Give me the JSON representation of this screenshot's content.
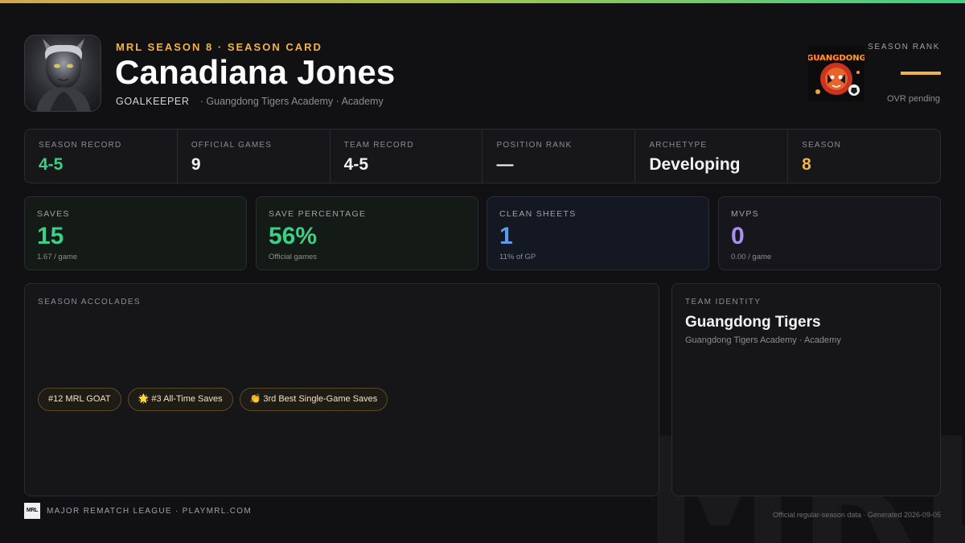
{
  "colors": {
    "accent_gold": "#f0b34a",
    "green": "#3dcf85",
    "blue": "#5b9cf0",
    "purple": "#a98ff0"
  },
  "header": {
    "eyebrow": "MRL SEASON 8 · SEASON CARD",
    "player_name": "Canadiana Jones",
    "position": "GOALKEEPER",
    "team_line": "· Guangdong Tigers Academy · Academy",
    "team_logo_text": "GUANGDONG",
    "rank_label": "SEASON RANK",
    "rank_sub": "OVR pending"
  },
  "summary": [
    {
      "label": "SEASON RECORD",
      "value": "4-5",
      "color": "#3dcf85"
    },
    {
      "label": "OFFICIAL GAMES",
      "value": "9",
      "color": "#f2f2f2"
    },
    {
      "label": "TEAM RECORD",
      "value": "4-5",
      "color": "#f2f2f2"
    },
    {
      "label": "POSITION RANK",
      "value": "—",
      "color": "#f2f2f2"
    },
    {
      "label": "ARCHETYPE",
      "value": "Developing",
      "color": "#f2f2f2"
    },
    {
      "label": "SEASON",
      "value": "8",
      "color": "#f0b34a"
    }
  ],
  "stats": [
    {
      "label": "SAVES",
      "value": "15",
      "sub": "1.67 / game",
      "color": "#3dcf85",
      "bg": "#141b17"
    },
    {
      "label": "SAVE PERCENTAGE",
      "value": "56%",
      "sub": "Official games",
      "color": "#3dcf85",
      "bg": "#141b17"
    },
    {
      "label": "CLEAN SHEETS",
      "value": "1",
      "sub": "11% of GP",
      "color": "#5b9cf0",
      "bg": "#141823"
    },
    {
      "label": "MVPS",
      "value": "0",
      "sub": "0.00 / game",
      "color": "#a98ff0",
      "bg": "#17161d"
    }
  ],
  "accolades_panel": {
    "label": "SEASON ACCOLADES",
    "chips": [
      "#12 MRL GOAT",
      "🌟 #3 All-Time Saves",
      "👏 3rd Best Single-Game Saves"
    ]
  },
  "team_panel": {
    "label": "TEAM IDENTITY",
    "team_name": "Guangdong Tigers",
    "team_sub": "Guangdong Tigers Academy · Academy"
  },
  "footer": {
    "logo_text": "MRL",
    "text": "MAJOR REMATCH LEAGUE · PLAYMRL.COM",
    "note": "Official regular-season data · Generated 2026-09-05",
    "watermark": "MRL"
  }
}
